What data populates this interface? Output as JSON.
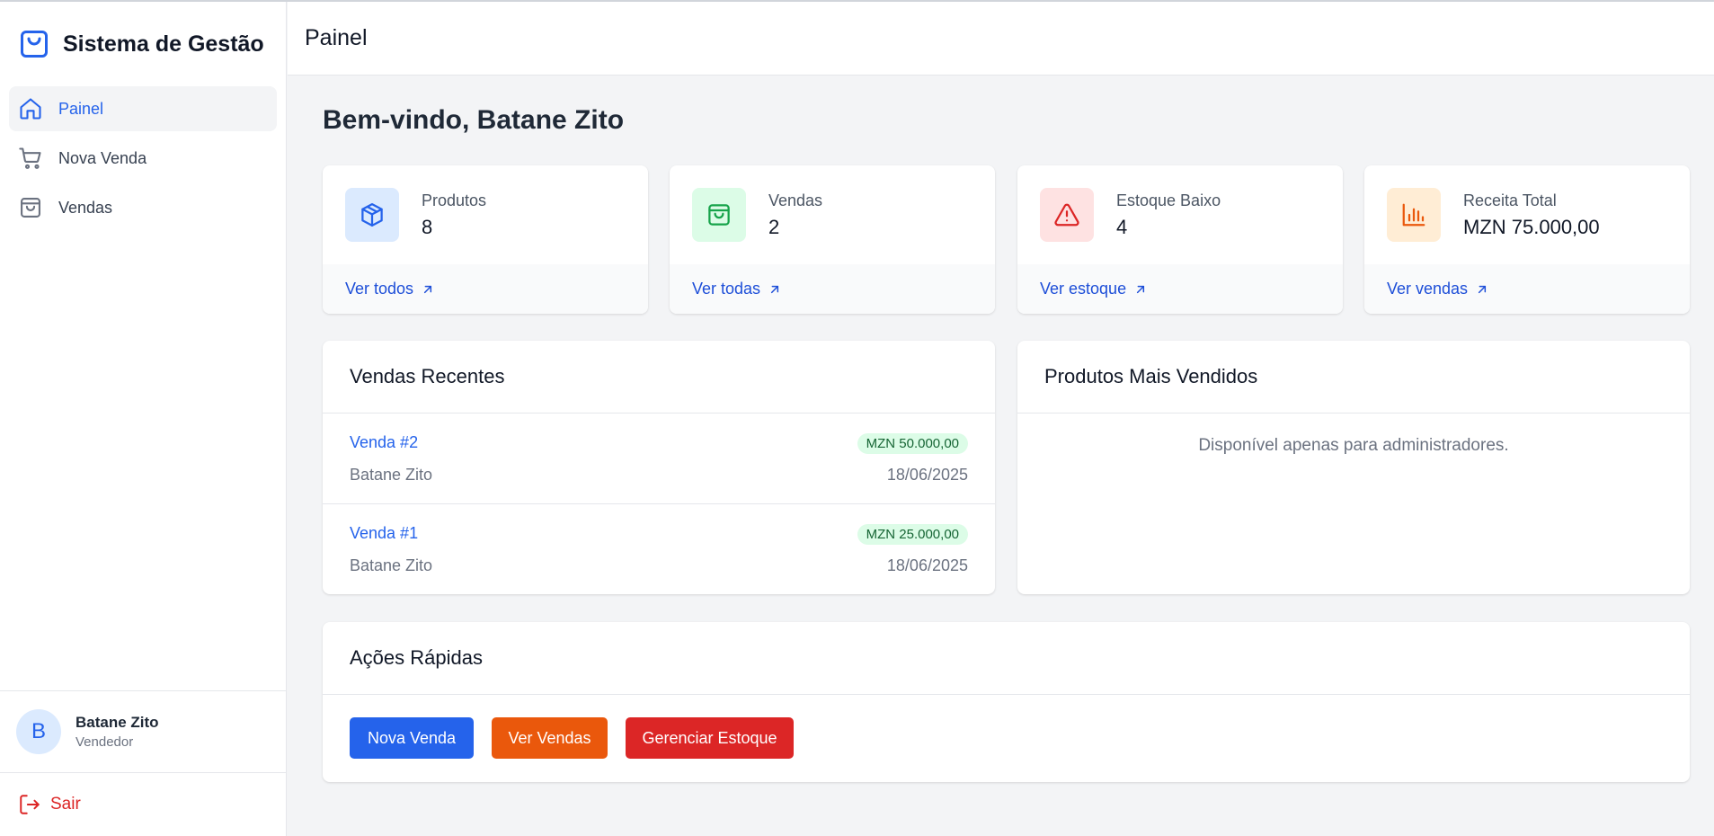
{
  "app": {
    "title": "Sistema de Gestão"
  },
  "sidebar": {
    "items": [
      {
        "label": "Painel",
        "icon": "home-icon",
        "active": true
      },
      {
        "label": "Nova Venda",
        "icon": "cart-icon",
        "active": false
      },
      {
        "label": "Vendas",
        "icon": "shopping-bag-icon",
        "active": false
      }
    ],
    "user": {
      "initial": "B",
      "name": "Batane Zito",
      "role": "Vendedor"
    },
    "logout_label": "Sair"
  },
  "header": {
    "title": "Painel"
  },
  "main": {
    "welcome": "Bem-vindo, Batane Zito",
    "stats": [
      {
        "label": "Produtos",
        "value": "8",
        "link": "Ver todos",
        "icon": "cube-icon",
        "color": "#2563eb",
        "bg": "#dbeafe"
      },
      {
        "label": "Vendas",
        "value": "2",
        "link": "Ver todas",
        "icon": "shopping-bag-icon",
        "color": "#16a34a",
        "bg": "#dcfce7"
      },
      {
        "label": "Estoque Baixo",
        "value": "4",
        "link": "Ver estoque",
        "icon": "warning-icon",
        "color": "#dc2626",
        "bg": "#fee2e2"
      },
      {
        "label": "Receita Total",
        "value": "MZN 75.000,00",
        "link": "Ver vendas",
        "icon": "bar-chart-icon",
        "color": "#ea580c",
        "bg": "#ffedd5"
      }
    ],
    "recent_sales": {
      "title": "Vendas Recentes",
      "rows": [
        {
          "id": "Venda #2",
          "amount": "MZN 50.000,00",
          "client": "Batane Zito",
          "date": "18/06/2025"
        },
        {
          "id": "Venda #1",
          "amount": "MZN 25.000,00",
          "client": "Batane Zito",
          "date": "18/06/2025"
        }
      ]
    },
    "top_products": {
      "title": "Produtos Mais Vendidos",
      "note": "Disponível apenas para administradores."
    },
    "quick_actions": {
      "title": "Ações Rápidas",
      "buttons": [
        {
          "label": "Nova Venda",
          "color": "#2563eb"
        },
        {
          "label": "Ver Vendas",
          "color": "#ea580c"
        },
        {
          "label": "Gerenciar Estoque",
          "color": "#dc2626"
        }
      ]
    }
  }
}
